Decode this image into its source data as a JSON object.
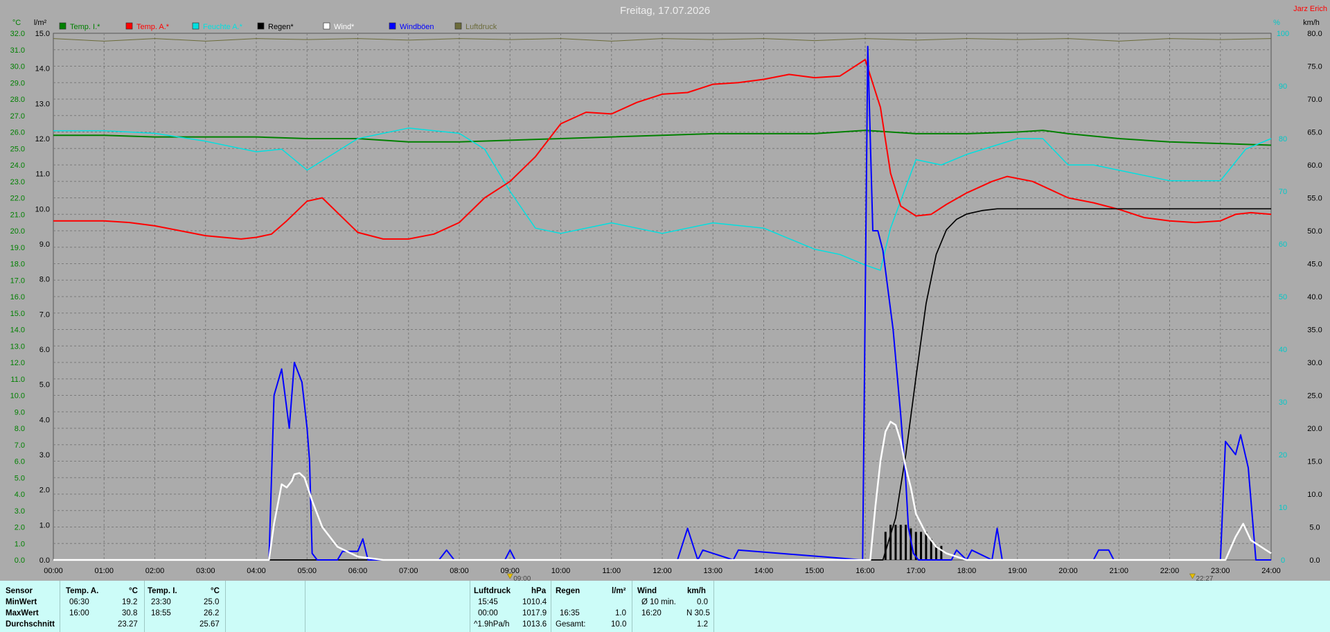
{
  "page_title": "Freitag, 17.07.2026",
  "author": "Jarz Erich",
  "colors": {
    "background": "#ababab",
    "temp_inner": "#008000",
    "temp_outer": "#ff0000",
    "humidity": "#00e0e0",
    "rain": "#000000",
    "wind": "#ffffff",
    "gust": "#0000ff",
    "pressure": "#6b6b3a",
    "axis_green": "#008000",
    "axis_cyan": "#00c8c8",
    "author": "#ff0000"
  },
  "chart_data": {
    "type": "line",
    "x_unit": "hours",
    "xlim": [
      0,
      24
    ],
    "x_ticks": [
      "00:00",
      "01:00",
      "02:00",
      "03:00",
      "04:00",
      "05:00",
      "06:00",
      "07:00",
      "08:00",
      "09:00",
      "10:00",
      "11:00",
      "12:00",
      "13:00",
      "14:00",
      "15:00",
      "16:00",
      "17:00",
      "18:00",
      "19:00",
      "20:00",
      "21:00",
      "22:00",
      "23:00",
      "24:00"
    ],
    "axes": {
      "temp_c": {
        "unit": "°C",
        "range": [
          0,
          32
        ],
        "ticks": [
          "0.0",
          "1.0",
          "2.0",
          "3.0",
          "4.0",
          "5.0",
          "6.0",
          "7.0",
          "8.0",
          "9.0",
          "10.0",
          "11.0",
          "12.0",
          "13.0",
          "14.0",
          "15.0",
          "16.0",
          "17.0",
          "18.0",
          "19.0",
          "20.0",
          "21.0",
          "22.0",
          "23.0",
          "24.0",
          "25.0",
          "26.0",
          "27.0",
          "28.0",
          "29.0",
          "30.0",
          "31.0",
          "32.0"
        ]
      },
      "rain_lm2": {
        "unit": "l/m²",
        "range": [
          0,
          15
        ],
        "ticks": [
          "0.0",
          "1.0",
          "2.0",
          "3.0",
          "4.0",
          "5.0",
          "6.0",
          "7.0",
          "8.0",
          "9.0",
          "10.0",
          "11.0",
          "12.0",
          "13.0",
          "14.0",
          "15.0"
        ]
      },
      "humidity_pct": {
        "unit": "%",
        "range": [
          0,
          100
        ],
        "ticks": [
          "0",
          "10",
          "20",
          "30",
          "40",
          "50",
          "60",
          "70",
          "80",
          "90",
          "100"
        ]
      },
      "wind_kmh": {
        "unit": "km/h",
        "range": [
          0,
          80
        ],
        "ticks": [
          "0.0",
          "5.0",
          "10.0",
          "15.0",
          "20.0",
          "25.0",
          "30.0",
          "35.0",
          "40.0",
          "45.0",
          "50.0",
          "55.0",
          "60.0",
          "65.0",
          "70.0",
          "75.0",
          "80.0"
        ]
      }
    },
    "legend": [
      {
        "name": "Temp. I.*",
        "color": "#008000"
      },
      {
        "name": "Temp. A.*",
        "color": "#ff0000"
      },
      {
        "name": "Feuchte A.*",
        "color": "#00e0e0"
      },
      {
        "name": "Regen*",
        "color": "#000000"
      },
      {
        "name": "Wind*",
        "color": "#ffffff"
      },
      {
        "name": "Windböen",
        "color": "#0000ff"
      },
      {
        "name": "Luftdruck",
        "color": "#6b6b3a"
      }
    ],
    "series": [
      {
        "name": "Temp. I.*",
        "axis": "temp_c",
        "x": [
          0,
          1,
          2,
          3,
          4,
          5,
          6,
          7,
          8,
          9,
          10,
          11,
          12,
          13,
          14,
          15,
          16,
          17,
          18,
          19,
          19.5,
          20,
          21,
          22,
          23,
          24
        ],
        "y": [
          25.8,
          25.8,
          25.7,
          25.7,
          25.7,
          25.6,
          25.6,
          25.4,
          25.4,
          25.5,
          25.6,
          25.7,
          25.8,
          25.9,
          25.9,
          25.9,
          26.1,
          25.9,
          25.9,
          26.0,
          26.1,
          25.9,
          25.6,
          25.4,
          25.3,
          25.2
        ]
      },
      {
        "name": "Temp. A.*",
        "axis": "temp_c",
        "x": [
          0,
          1,
          1.5,
          2,
          2.5,
          3,
          3.7,
          4,
          4.3,
          4.6,
          5.0,
          5.3,
          6.0,
          6.5,
          7,
          7.5,
          8.0,
          8.5,
          9.0,
          9.5,
          10,
          10.5,
          11,
          11.5,
          12,
          12.5,
          13,
          13.5,
          14,
          14.5,
          15,
          15.5,
          16.0,
          16.3,
          16.5,
          16.7,
          17.0,
          17.3,
          17.6,
          18,
          18.5,
          18.8,
          19.3,
          20,
          20.5,
          21,
          21.5,
          22,
          22.5,
          23,
          23.3,
          23.6,
          24
        ],
        "y": [
          20.6,
          20.6,
          20.5,
          20.3,
          20.0,
          19.7,
          19.5,
          19.6,
          19.8,
          20.6,
          21.8,
          22.0,
          19.9,
          19.5,
          19.5,
          19.8,
          20.5,
          22.0,
          23.0,
          24.5,
          26.5,
          27.2,
          27.1,
          27.8,
          28.3,
          28.4,
          28.9,
          29.0,
          29.2,
          29.5,
          29.3,
          29.4,
          30.4,
          27.5,
          23.5,
          21.5,
          20.9,
          21.0,
          21.6,
          22.3,
          23.0,
          23.3,
          23.0,
          22.0,
          21.7,
          21.3,
          20.8,
          20.6,
          20.5,
          20.6,
          21.0,
          21.1,
          21.0
        ]
      },
      {
        "name": "Feuchte A.*",
        "axis": "humidity_pct",
        "x": [
          0,
          1,
          2,
          3,
          4,
          4.5,
          5,
          5.5,
          6,
          7,
          8,
          8.5,
          9,
          9.5,
          10,
          11,
          12,
          13,
          14,
          15,
          15.5,
          16,
          16.3,
          16.5,
          17,
          17.5,
          18,
          19,
          19.5,
          20,
          20.5,
          21,
          22,
          22.5,
          23,
          23.5,
          24
        ],
        "y": [
          81.5,
          81.5,
          81,
          79.5,
          77.5,
          78,
          74,
          77,
          80,
          82,
          81,
          78,
          70,
          63,
          62,
          64,
          62,
          64,
          63,
          59,
          58,
          56,
          55,
          63,
          76,
          75,
          77,
          80,
          80,
          75,
          75,
          74,
          72,
          72,
          72,
          78,
          80
        ]
      },
      {
        "name": "Regen*",
        "axis": "rain_lm2",
        "x": [
          0,
          16.35,
          16.6,
          16.8,
          17.0,
          17.2,
          17.4,
          17.6,
          17.8,
          18.0,
          18.3,
          18.6,
          19.0,
          20,
          24
        ],
        "y": [
          0,
          0,
          1.2,
          3.0,
          5.2,
          7.3,
          8.7,
          9.4,
          9.7,
          9.85,
          9.95,
          10.0,
          10.0,
          10.0,
          10.0
        ]
      },
      {
        "name": "Wind*",
        "axis": "wind_kmh",
        "x": [
          0,
          4.25,
          4.35,
          4.5,
          4.6,
          4.7,
          4.75,
          4.85,
          4.95,
          5.1,
          5.3,
          5.6,
          6.0,
          6.5,
          16.1,
          16.2,
          16.3,
          16.4,
          16.5,
          16.6,
          16.7,
          16.8,
          16.9,
          17.0,
          17.2,
          17.4,
          17.6,
          18.0,
          23.1,
          23.3,
          23.45,
          23.6,
          24
        ],
        "y": [
          0,
          0,
          5.5,
          11.5,
          11,
          12.0,
          13.0,
          13.2,
          12.5,
          9.0,
          5.0,
          2.0,
          0.5,
          0,
          0,
          8.0,
          15.0,
          19.5,
          21.0,
          20.5,
          18.0,
          14.0,
          11.0,
          7.0,
          4.0,
          2.0,
          1.0,
          0,
          0,
          3.5,
          5.5,
          3.0,
          1.0
        ]
      },
      {
        "name": "Windböen",
        "axis": "wind_kmh",
        "x": [
          0,
          4.25,
          4.35,
          4.5,
          4.65,
          4.75,
          4.9,
          5.0,
          5.05,
          5.1,
          5.2,
          5.6,
          5.7,
          6.0,
          6.1,
          6.2,
          7.6,
          7.75,
          7.9,
          8.9,
          9.0,
          9.1,
          12.3,
          12.5,
          12.7,
          12.8,
          13.4,
          13.5,
          15.95,
          16.05,
          16.15,
          16.25,
          16.35,
          16.55,
          16.7,
          16.8,
          16.85,
          16.95,
          17.05,
          17.2,
          17.7,
          17.8,
          18.0,
          18.1,
          18.5,
          18.6,
          18.7,
          20.5,
          20.6,
          20.8,
          20.9,
          23.0,
          23.1,
          23.3,
          23.4,
          23.55,
          23.7,
          24
        ],
        "y": [
          0,
          0,
          25,
          29,
          20,
          30,
          27,
          20,
          15,
          1,
          0,
          0,
          1.3,
          1.3,
          3.2,
          0,
          0,
          1.5,
          0,
          0,
          1.5,
          0,
          0,
          4.8,
          0,
          1.5,
          0,
          1.5,
          0,
          78,
          50,
          50,
          47,
          35,
          22,
          12,
          5,
          1,
          0,
          0,
          0,
          1.5,
          0,
          1.5,
          0,
          4.8,
          0,
          0,
          1.5,
          1.5,
          0,
          0,
          18,
          16,
          19,
          14,
          0,
          0
        ]
      },
      {
        "name": "Luftdruck",
        "axis": "pressure_norm",
        "x": [
          0,
          1,
          2,
          3,
          4,
          5,
          6,
          7,
          8,
          9,
          10,
          11,
          12,
          13,
          14,
          15,
          16,
          17,
          18,
          19,
          20,
          21,
          22,
          23,
          24
        ],
        "y": [
          0.99,
          0.985,
          0.99,
          0.985,
          0.99,
          0.988,
          0.99,
          0.987,
          0.99,
          0.988,
          0.99,
          0.985,
          0.99,
          0.988,
          0.99,
          0.986,
          0.99,
          0.987,
          0.99,
          0.988,
          0.99,
          0.985,
          0.99,
          0.988,
          0.99
        ]
      }
    ],
    "rain_bars": {
      "x": [
        16.4,
        16.5,
        16.6,
        16.7,
        16.8,
        16.9,
        17.0,
        17.1,
        17.2,
        17.3,
        17.4,
        17.5
      ],
      "y": [
        0.8,
        1.0,
        1.0,
        1.0,
        1.0,
        0.9,
        0.8,
        0.8,
        0.8,
        0.6,
        0.4,
        0.4
      ]
    },
    "markers": [
      {
        "x": 9.0,
        "label": "09:00"
      },
      {
        "x": 22.45,
        "label": "22:27"
      }
    ]
  },
  "summary": {
    "rows": [
      "Sensor",
      "MinWert",
      "MaxWert",
      "Durchschnitt"
    ],
    "temp_a": {
      "header": "Temp. A.",
      "unit": "°C",
      "min_time": "06:30",
      "min": "19.2",
      "max_time": "16:00",
      "max": "30.8",
      "avg": "23.27"
    },
    "temp_i": {
      "header": "Temp. I.",
      "unit": "°C",
      "min_time": "23:30",
      "min": "25.0",
      "max_time": "18:55",
      "max": "26.2",
      "avg": "25.67"
    },
    "pressure": {
      "header": "Luftdruck",
      "unit": "hPa",
      "min_time": "15:45",
      "min": "1010.4",
      "max_time": "00:00",
      "max": "1017.9",
      "trend": "^1.9hPa/h",
      "avg": "1013.6"
    },
    "rain": {
      "header": "Regen",
      "unit": "l/m²",
      "max_time": "16:35",
      "max": "1.0",
      "total_label": "Gesamt:",
      "total": "10.0"
    },
    "wind": {
      "header": "Wind",
      "unit": "km/h",
      "min_label": "Ø 10 min.",
      "min": "0.0",
      "max_time": "16:20",
      "max": "N 30.5",
      "avg": "1.2"
    }
  }
}
